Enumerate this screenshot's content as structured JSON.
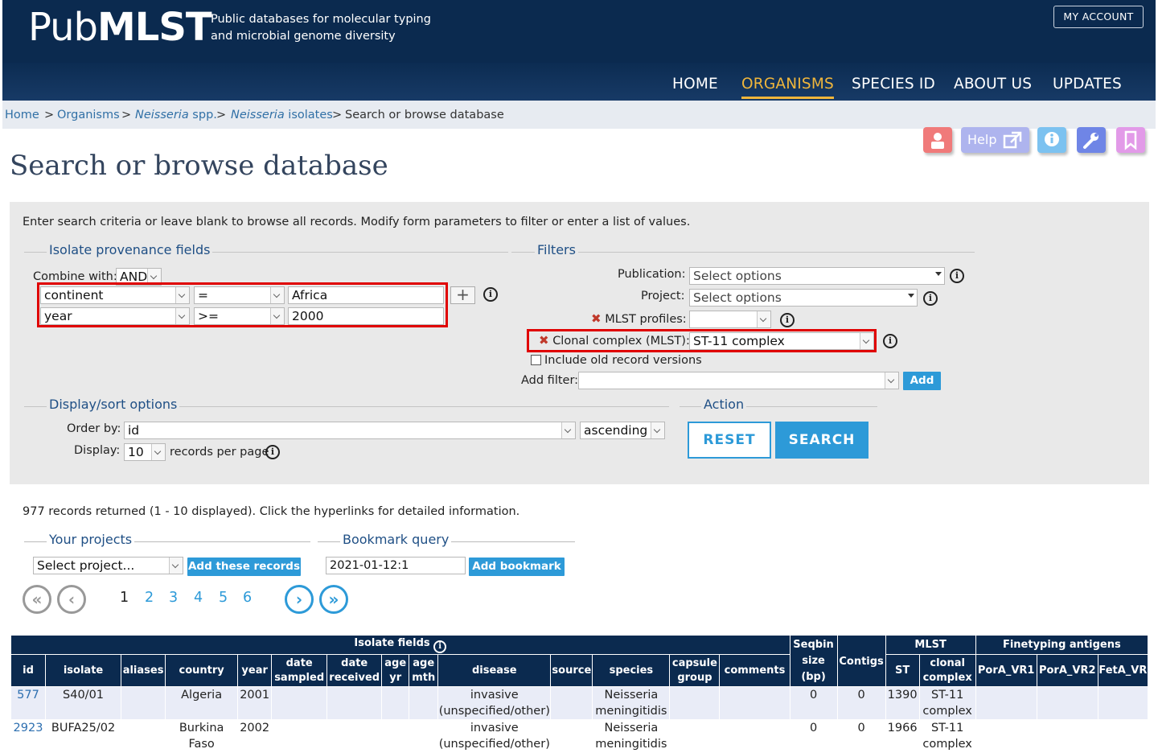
{
  "header": {
    "logo_light": "Pub",
    "logo_bold": "MLST",
    "tagline_1": "Public databases for molecular typing",
    "tagline_2": "and microbial genome diversity",
    "account": "MY ACCOUNT",
    "nav": [
      "HOME",
      "ORGANISMS",
      "SPECIES ID",
      "ABOUT US",
      "UPDATES"
    ],
    "active_nav": "ORGANISMS"
  },
  "breadcrumb": {
    "home": "Home",
    "organisms": "Organisms",
    "neisseria_it": "Neisseria",
    "neisseria_rest": " spp.",
    "isolates_it": "Neisseria",
    "isolates_rest": " isolates",
    "current": "Search or browse database",
    "sep": ">"
  },
  "tools": {
    "help": "Help"
  },
  "page_title": "Search or browse database",
  "form": {
    "intro": "Enter search criteria or leave blank to browse all records. Modify form parameters to filter or enter a list of values.",
    "provenance_legend": "Isolate provenance fields",
    "combine_label": "Combine with:",
    "combine_value": "AND",
    "rows": [
      {
        "field": "continent",
        "op": "=",
        "value": "Africa"
      },
      {
        "field": "year",
        "op": ">=",
        "value": "2000"
      }
    ],
    "filters_legend": "Filters",
    "publication_label": "Publication:",
    "publication_value": "Select options",
    "project_label": "Project:",
    "project_value": "Select options",
    "mlst_profiles_label": "MLST profiles:",
    "mlst_profiles_value": "",
    "clonal_label": "Clonal complex (MLST):",
    "clonal_value": "ST-11 complex",
    "old_versions_label": "Include old record versions",
    "add_filter_label": "Add filter:",
    "add_filter_button": "Add",
    "display_legend": "Display/sort options",
    "order_label": "Order by:",
    "order_value": "id",
    "direction_value": "ascending",
    "display_label": "Display:",
    "display_value": "10",
    "per_page": "records per page",
    "action_legend": "Action",
    "reset": "RESET",
    "search": "SEARCH"
  },
  "results": {
    "summary": "977 records returned (1 - 10 displayed). Click the hyperlinks for detailed information.",
    "projects_legend": "Your projects",
    "project_select": "Select project...",
    "add_records": "Add these records",
    "bookmark_legend": "Bookmark query",
    "bookmark_value": "2021-01-12:1",
    "add_bookmark": "Add bookmark",
    "pages": [
      "1",
      "2",
      "3",
      "4",
      "5",
      "6"
    ],
    "current_page": "1",
    "first": "«",
    "prev": "‹",
    "next": "›",
    "last": "»"
  },
  "table": {
    "group_isolate": "Isolate fields",
    "group_seqbin": "Seqbin size (bp)",
    "group_contigs": "Contigs",
    "group_mlst": "MLST",
    "group_finetyping": "Finetyping antigens",
    "columns": [
      "id",
      "isolate",
      "aliases",
      "country",
      "year",
      "date sampled",
      "date received",
      "age yr",
      "age mth",
      "disease",
      "source",
      "species",
      "capsule group",
      "comments",
      "ST",
      "clonal complex",
      "PorA_VR1",
      "PorA_VR2",
      "FetA_VR"
    ],
    "rows": [
      {
        "id": "577",
        "isolate": "S40/01",
        "aliases": "",
        "country": "Algeria",
        "year": "2001",
        "date_sampled": "",
        "date_received": "",
        "age_yr": "",
        "age_mth": "",
        "disease": "invasive (unspecified/other)",
        "source": "",
        "species": "Neisseria meningitidis",
        "capsule": "",
        "comments": "",
        "seqbin": "0",
        "contigs": "0",
        "st": "1390",
        "cc": "ST-11 complex",
        "vr1": "",
        "vr2": "",
        "fetA": ""
      },
      {
        "id": "2923",
        "isolate": "BUFA25/02",
        "aliases": "",
        "country": "Burkina Faso",
        "year": "2002",
        "date_sampled": "",
        "date_received": "",
        "age_yr": "",
        "age_mth": "",
        "disease": "invasive (unspecified/other)",
        "source": "",
        "species": "Neisseria meningitidis",
        "capsule": "",
        "comments": "",
        "seqbin": "0",
        "contigs": "0",
        "st": "1966",
        "cc": "ST-11 complex",
        "vr1": "",
        "vr2": "",
        "fetA": ""
      }
    ]
  },
  "colors": {
    "navy": "#0b2a4f",
    "accent": "#f0b63b",
    "link": "#3170a6",
    "button": "#2d9ad8",
    "highlight": "#e00000"
  }
}
